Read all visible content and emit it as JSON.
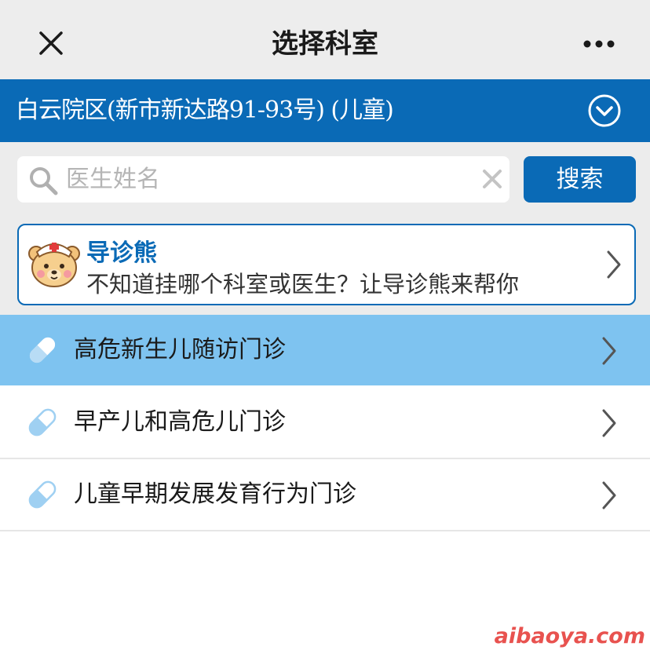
{
  "header": {
    "title": "选择科室",
    "close_icon": "close-icon",
    "more_icon": "more-dots-icon"
  },
  "campus": {
    "name": "白云院区(新市新达路91-93号) (儿童)",
    "toggle_icon": "chevron-down-circle-icon",
    "color": "#0a6ab6"
  },
  "search": {
    "placeholder": "医生姓名",
    "value": "",
    "button_label": "搜索",
    "icon": "search-icon",
    "clear_icon": "clear-icon"
  },
  "guide": {
    "title": "导诊熊",
    "description": "不知道挂哪个科室或医生？让导诊熊来帮你",
    "icon": "bear-mascot-icon"
  },
  "departments": [
    {
      "label": "高危新生儿随访门诊",
      "active": true
    },
    {
      "label": "早产儿和高危儿门诊",
      "active": false
    },
    {
      "label": "儿童早期发展发育行为门诊",
      "active": false
    }
  ],
  "colors": {
    "accent": "#0a6ab6",
    "active_row": "#7ec3f0",
    "pill_icon": "#9fd0f2"
  },
  "watermark": "aibaoya.com"
}
